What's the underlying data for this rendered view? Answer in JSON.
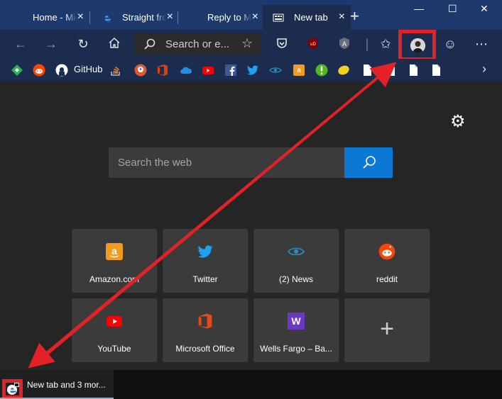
{
  "tabs": [
    {
      "title": "Home - Microsoft Store",
      "icon": "microsoft-logo-icon"
    },
    {
      "title": "Straight from Microsoft",
      "icon": "edge-logo-icon"
    },
    {
      "title": "Reply to Message",
      "icon": "microsoft-logo-icon"
    },
    {
      "title": "New tab",
      "icon": "new-tab-page-icon",
      "active": true
    }
  ],
  "address_bar": {
    "placeholder": "Search or e..."
  },
  "bookmarks": {
    "github_label": "GitHub",
    "icons": [
      "feedly-icon",
      "reddit-icon",
      "github-icon",
      "stack-overflow-icon",
      "duckduckgo-icon",
      "office-icon",
      "onedrive-icon",
      "youtube-icon",
      "facebook-icon",
      "twitter-icon",
      "news-eye-icon",
      "amazon-icon",
      "exclamation-icon",
      "lemon-icon",
      "page-icon",
      "page-icon",
      "page-icon",
      "page-icon"
    ]
  },
  "search": {
    "placeholder": "Search the web"
  },
  "top_sites": [
    {
      "label": "Amazon.com",
      "icon": "amazon-icon",
      "color": "#f29a1e"
    },
    {
      "label": "Twitter",
      "icon": "twitter-icon",
      "color": "#1da1f2"
    },
    {
      "label": "(2) News",
      "icon": "news-eye-icon",
      "color": "#2a8fbd"
    },
    {
      "label": "reddit",
      "icon": "reddit-icon",
      "color": "#ff4500"
    },
    {
      "label": "YouTube",
      "icon": "youtube-icon",
      "color": "#ff0000"
    },
    {
      "label": "Microsoft Office",
      "icon": "office-icon",
      "color": "#e64a19"
    },
    {
      "label": "Wells Fargo – Ba...",
      "icon": "wells-fargo-icon",
      "color": "#6b3ac4",
      "icon_letter": "W"
    }
  ],
  "taskbar": {
    "label": "New tab and 3 mor..."
  },
  "colors": {
    "frame": "#1b2c4e",
    "tabstrip": "#1e3a6c",
    "accent": "#0a78d4",
    "annotation": "#e32227"
  }
}
